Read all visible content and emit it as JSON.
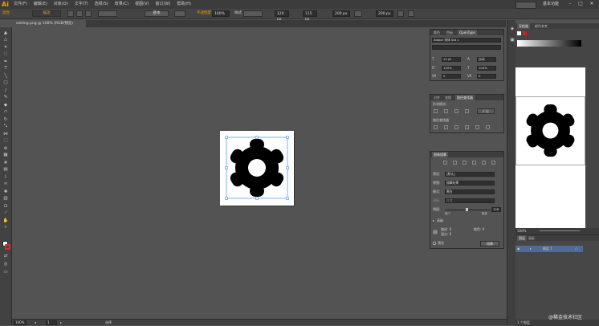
{
  "menubar": {
    "logo": "Ai",
    "items": [
      "文件(F)",
      "编辑(E)",
      "对象(O)",
      "文字(T)",
      "选择(S)",
      "效果(C)",
      "视图(V)",
      "窗口(W)",
      "帮助(H)"
    ],
    "workspace": "基本功能"
  },
  "control": {
    "mode": "混合",
    "fill_label": "描边",
    "shape_label": "基本",
    "opacity_label": "不透明度",
    "opacity": "100%",
    "style_label": "样式",
    "x": "120 px",
    "y": "115 px",
    "w": "200 px",
    "h": "200 px"
  },
  "tab": {
    "label": "setting.png @ 100% (RGB/预览)"
  },
  "color_panel": {
    "tabs": [
      "颜色",
      "色板",
      "OpenType"
    ],
    "font": "Adobe 宋体 Std L",
    "size_a": "12 pt",
    "size_b": "100%",
    "size_c": "自动",
    "size_d": "0",
    "lead": "100%",
    "kern": "0"
  },
  "pathfinder": {
    "tabs": [
      "对齐",
      "变换",
      "路径查找器"
    ],
    "shape_mode": "形状模式:",
    "pathfinders": "路径查找器:",
    "expand": "扩展"
  },
  "image_trace": {
    "title": "图像描摹",
    "preset_label": "预设:",
    "preset": "[默认]",
    "view_label": "视图:",
    "view": "描摹结果",
    "mode_label": "模式:",
    "mode": "黑白",
    "palette_label": "调板:",
    "palette": "灰度",
    "threshold_label": "阈值:",
    "threshold": "128",
    "less": "较少",
    "more": "较多",
    "advanced": "高级",
    "paths_label": "路径: 0",
    "colors_label": "颜色: 0",
    "anchors_label": "锚点: 0",
    "preview": "预览",
    "trace_button": "描摹"
  },
  "navigator": {
    "tabs": [
      "导航器",
      "颜色参考"
    ],
    "zoom": "100%"
  },
  "layers": {
    "tabs": [
      "图层",
      "画板"
    ],
    "row": "图层 1",
    "count": "1 个图层"
  },
  "status": {
    "zoom": "100%",
    "page": "1",
    "label": "选择"
  },
  "watermark": "@稀金技术社区",
  "colors": {
    "accent": "#ff9a00",
    "selection": "#4a90e2",
    "gear": "#000000"
  }
}
